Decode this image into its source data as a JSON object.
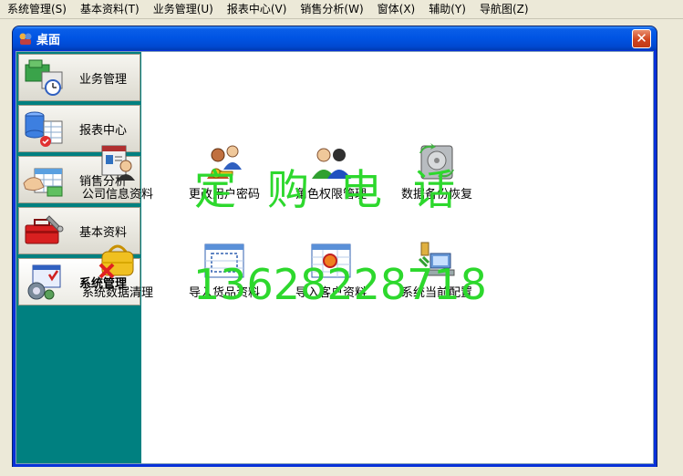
{
  "menu": [
    "系统管理(S)",
    "基本资料(T)",
    "业务管理(U)",
    "报表中心(V)",
    "销售分析(W)",
    "窗体(X)",
    "辅助(Y)",
    "导航图(Z)"
  ],
  "window": {
    "title": "桌面",
    "close_symbol": "✕"
  },
  "sidebar": {
    "items": [
      {
        "label": "业务管理",
        "icon": "business-icon"
      },
      {
        "label": "报表中心",
        "icon": "report-icon"
      },
      {
        "label": "销售分析",
        "icon": "sales-analysis-icon"
      },
      {
        "label": "基本资料",
        "icon": "toolbox-icon"
      },
      {
        "label": "系统管理",
        "icon": "system-settings-icon"
      }
    ],
    "active": "系统管理"
  },
  "main": {
    "tiles": [
      {
        "label": "公司信息资料",
        "icon": "company-info-icon"
      },
      {
        "label": "更改用户密码",
        "icon": "change-password-icon"
      },
      {
        "label": "角色权限管理",
        "icon": "role-permission-icon"
      },
      {
        "label": "数据备份恢复",
        "icon": "backup-restore-icon"
      },
      {
        "label": "系统数据清理",
        "icon": "data-cleanup-icon"
      },
      {
        "label": "导入货品资料",
        "icon": "import-goods-icon"
      },
      {
        "label": "导入客户资料",
        "icon": "import-customers-icon"
      },
      {
        "label": "系统当前配置",
        "icon": "system-config-icon"
      }
    ]
  },
  "watermark": {
    "title": "定购电话",
    "phone": "13628228718",
    "color": "#2dd82d"
  }
}
